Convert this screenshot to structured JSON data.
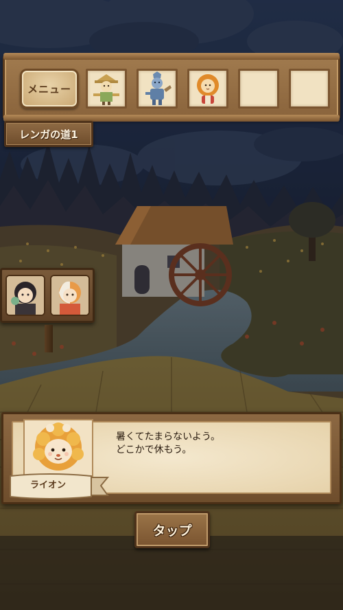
{
  "menu": {
    "label": "メニュー"
  },
  "inventory": {
    "slots": [
      {
        "character": "scarecrow",
        "filled": true
      },
      {
        "character": "tin-woodman",
        "filled": true
      },
      {
        "character": "lion",
        "filled": true
      },
      {
        "character": "",
        "filled": false
      },
      {
        "character": "",
        "filled": false
      }
    ]
  },
  "stage": {
    "name": "レンガの道1"
  },
  "side_sign": {
    "characters": [
      "dark-haired-companion",
      "orange-haired-companion"
    ]
  },
  "dialog": {
    "speaker": "ライオン",
    "lines": [
      "暑くてたまらないよう。",
      "どこかで休もう。"
    ]
  },
  "tap": {
    "label": "タップ"
  },
  "colors": {
    "wood": "#8c6842",
    "wood_dark": "#4a2f16",
    "paper": "#f4e8ce",
    "text": "#2a1c10",
    "sky": "#1e2a44"
  }
}
